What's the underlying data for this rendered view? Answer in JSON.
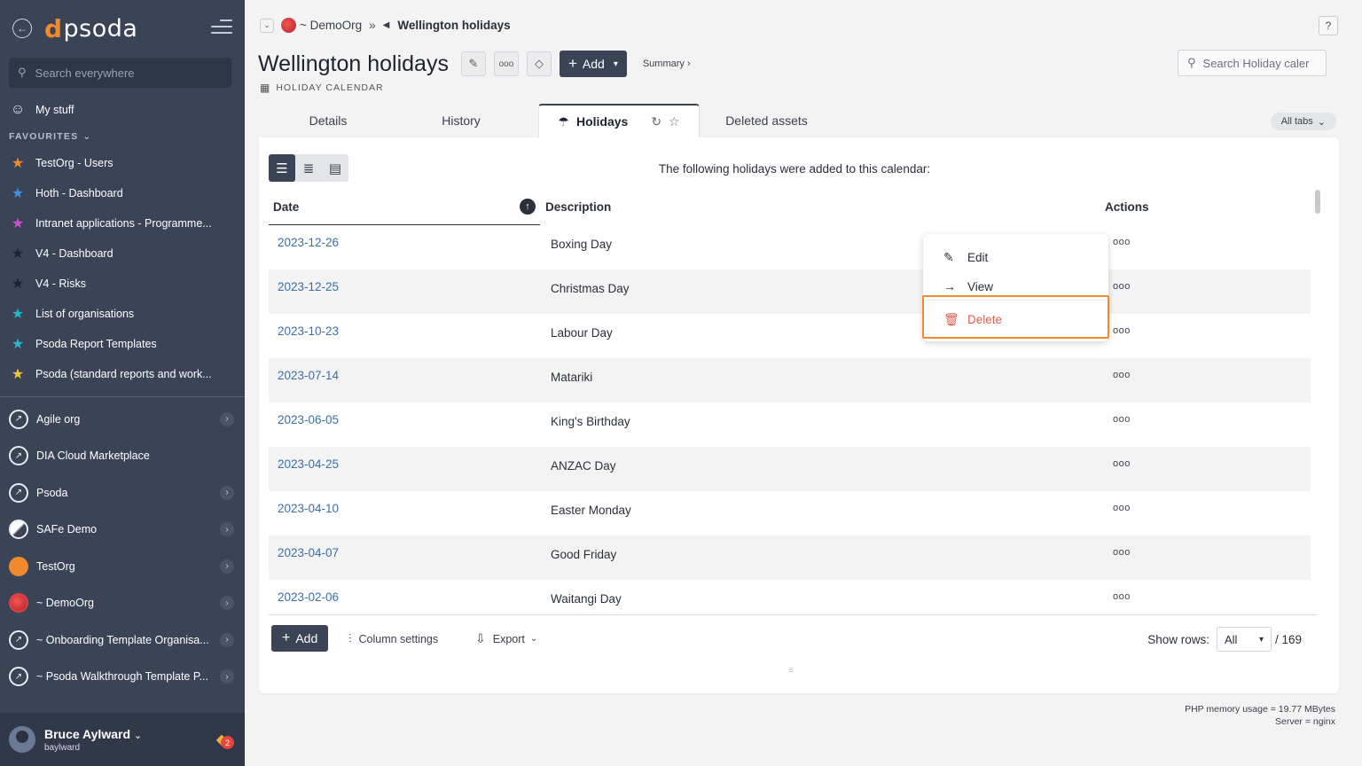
{
  "sidebar": {
    "logo": "psoda",
    "search_placeholder": "Search everywhere",
    "my_stuff": "My stuff",
    "favourites_heading": "FAVOURITES",
    "favourites": [
      {
        "label": "TestOrg - Users",
        "color": "#f08a2c"
      },
      {
        "label": "Hoth - Dashboard",
        "color": "#3a8ee6"
      },
      {
        "label": "Intranet applications - Programme...",
        "color": "#d14ed6"
      },
      {
        "label": "V4 - Dashboard",
        "color": "#2b2f3a"
      },
      {
        "label": "V4 - Risks",
        "color": "#2b2f3a"
      },
      {
        "label": "List of organisations",
        "color": "#29b6c9"
      },
      {
        "label": "Psoda Report Templates",
        "color": "#29b6c9"
      },
      {
        "label": "Psoda (standard reports and work...",
        "color": "#f0c43c"
      }
    ],
    "orgs": [
      {
        "label": "Agile org",
        "chevron": true,
        "style": "compass"
      },
      {
        "label": "DIA Cloud Marketplace",
        "chevron": false,
        "style": "compass"
      },
      {
        "label": "Psoda",
        "chevron": true,
        "style": "compass"
      },
      {
        "label": "SAFe Demo",
        "chevron": true,
        "style": "safe"
      },
      {
        "label": "TestOrg",
        "chevron": true,
        "style": "orange"
      },
      {
        "label": "~ DemoOrg",
        "chevron": true,
        "style": "red"
      },
      {
        "label": "~ Onboarding Template Organisa...",
        "chevron": true,
        "style": "compass"
      },
      {
        "label": "~ Psoda Walkthrough Template P...",
        "chevron": true,
        "style": "compass"
      }
    ],
    "user": {
      "name": "Bruce Aylward",
      "username": "baylward",
      "notifications": "2"
    }
  },
  "breadcrumb": {
    "org": "~ DemoOrg",
    "sep": "»",
    "current": "Wellington holidays"
  },
  "header": {
    "title": "Wellington holidays",
    "add_label": "Add",
    "summary_label": "Summary ›",
    "subtitle": "HOLIDAY CALENDAR",
    "search_placeholder": "Search Holiday caler",
    "help": "?"
  },
  "tabs": {
    "details": "Details",
    "history": "History",
    "holidays": "Holidays",
    "deleted": "Deleted assets",
    "all_tabs": "All tabs"
  },
  "table": {
    "intro": "The following holidays were added to this calendar:",
    "columns": {
      "date": "Date",
      "description": "Description",
      "actions": "Actions"
    },
    "action_glyph": "ooo",
    "rows": [
      {
        "date": "2023-12-26",
        "description": "Boxing Day"
      },
      {
        "date": "2023-12-25",
        "description": "Christmas Day"
      },
      {
        "date": "2023-10-23",
        "description": "Labour Day"
      },
      {
        "date": "2023-07-14",
        "description": "Matariki"
      },
      {
        "date": "2023-06-05",
        "description": "King's Birthday"
      },
      {
        "date": "2023-04-25",
        "description": "ANZAC Day"
      },
      {
        "date": "2023-04-10",
        "description": "Easter Monday"
      },
      {
        "date": "2023-04-07",
        "description": "Good Friday"
      },
      {
        "date": "2023-02-06",
        "description": "Waitangi Day"
      }
    ]
  },
  "footer": {
    "add_label": "Add",
    "column_settings": "Column settings",
    "export": "Export",
    "show_rows_label": "Show rows:",
    "show_rows_value": "All",
    "total": "/ 169"
  },
  "context_menu": {
    "edit": "Edit",
    "view": "View",
    "delete": "Delete"
  },
  "server_info": {
    "memory": "PHP memory usage = 19.77 MBytes",
    "server": "Server = nginx"
  },
  "colors": {
    "sidebar": "#3b4356",
    "accent": "#f08a2c",
    "link": "#3a6fa8",
    "danger": "#e05d4d"
  }
}
